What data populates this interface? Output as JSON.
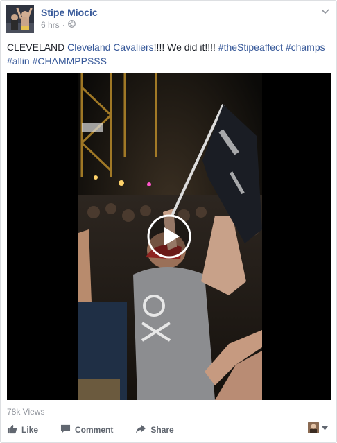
{
  "post": {
    "author": "Stipe Miocic",
    "time": "6 hrs",
    "privacy_sep": "·",
    "text_parts": [
      {
        "text": "CLEVELAND ",
        "link": false
      },
      {
        "text": "Cleveland Cavaliers",
        "link": true
      },
      {
        "text": "!!!! We did it!!!! ",
        "link": false
      },
      {
        "text": "#theStipeaffect",
        "link": true
      },
      {
        "text": " ",
        "link": false
      },
      {
        "text": "#champs",
        "link": true
      },
      {
        "text": " ",
        "link": false
      },
      {
        "text": "#allin",
        "link": true
      },
      {
        "text": " ",
        "link": false
      },
      {
        "text": "#CHAMMPPSSS",
        "link": true
      }
    ],
    "views": "78k Views"
  },
  "actions": {
    "like": "Like",
    "comment": "Comment",
    "share": "Share"
  },
  "icons": {
    "globe": "globe-icon",
    "chevron": "chevron-down-icon",
    "play": "play-icon",
    "like": "thumbs-up-icon",
    "comment": "comment-icon",
    "share": "share-arrow-icon",
    "dropdown": "caret-down-icon"
  },
  "colors": {
    "link": "#365899",
    "meta": "#90949c",
    "action": "#616770"
  }
}
